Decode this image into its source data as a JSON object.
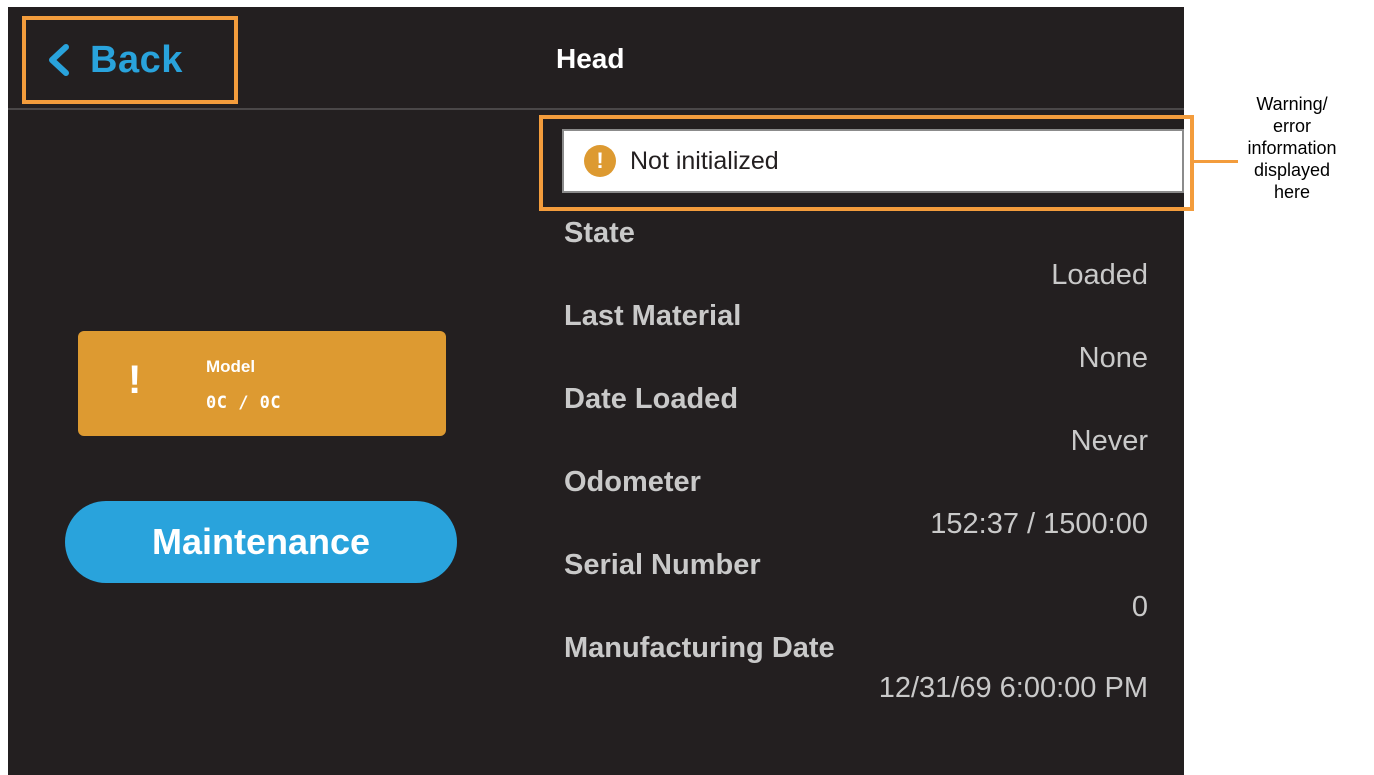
{
  "header": {
    "back_label": "Back",
    "back_icon": "chevron-left-icon",
    "title": "Head"
  },
  "status_card": {
    "icon": "exclamation-icon",
    "icon_glyph": "!",
    "label": "Model",
    "value": "0C / 0C"
  },
  "maintenance_label": "Maintenance",
  "warning": {
    "icon": "warning-circle-icon",
    "icon_glyph": "!",
    "text": "Not initialized"
  },
  "details": [
    {
      "label": "State",
      "value": "Loaded"
    },
    {
      "label": "Last Material",
      "value": "None"
    },
    {
      "label": "Date Loaded",
      "value": "Never"
    },
    {
      "label": "Odometer",
      "value": "152:37 / 1500:00"
    },
    {
      "label": "Serial Number",
      "value": "0"
    },
    {
      "label": "Manufacturing Date",
      "value": "12/31/69 6:00:00 PM"
    }
  ],
  "annotation": {
    "text": "Warning/ error information displayed here"
  },
  "colors": {
    "background": "#231f20",
    "accent_blue": "#29a3dc",
    "warning_orange": "#dd9a31",
    "callout_orange": "#f39c3c",
    "text_gray": "#c9c9c9"
  }
}
